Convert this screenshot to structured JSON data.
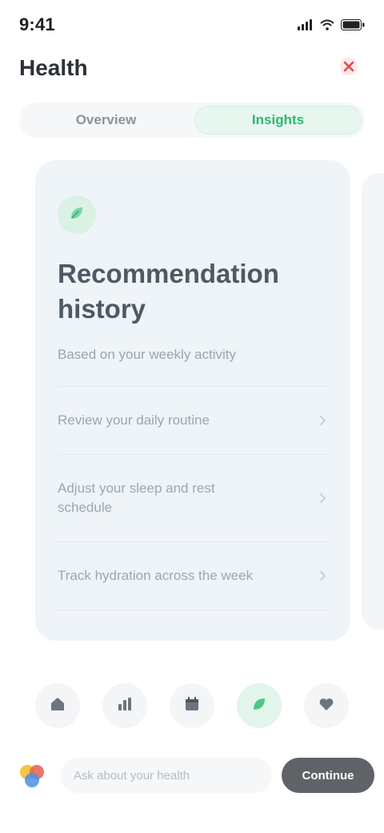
{
  "status_bar": {
    "time": "9:41"
  },
  "header": {
    "title": "Health",
    "action_icon": "close-icon"
  },
  "tabs": [
    {
      "label": "Overview",
      "active": false
    },
    {
      "label": "Insights",
      "active": true
    }
  ],
  "card": {
    "badge_icon": "leaf-icon",
    "title": "Recommendation history",
    "subtitle": "Based on your weekly activity",
    "options": [
      {
        "label": "Review your daily routine"
      },
      {
        "label": "Adjust your sleep and rest schedule"
      },
      {
        "label": "Track hydration across the week"
      }
    ]
  },
  "toolbar": {
    "buttons": [
      {
        "icon": "home-icon",
        "active": false
      },
      {
        "icon": "chart-icon",
        "active": false
      },
      {
        "icon": "calendar-icon",
        "active": false
      },
      {
        "icon": "leaf-icon",
        "active": true
      },
      {
        "icon": "heart-icon",
        "active": false
      }
    ]
  },
  "bottom": {
    "prompt_placeholder": "Ask about your health",
    "button_label": "Continue"
  },
  "colors": {
    "accent": "#2fb574",
    "card_bg": "#eff4f8",
    "danger": "#e5484d"
  }
}
